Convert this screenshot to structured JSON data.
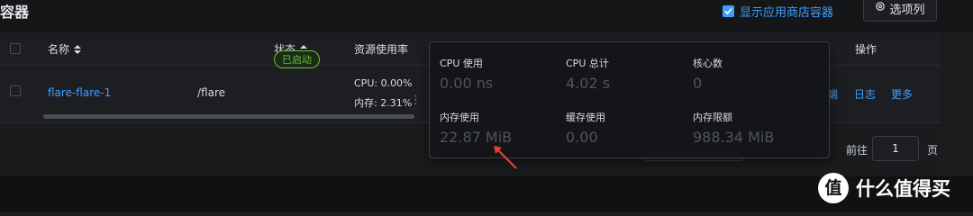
{
  "header": {
    "title": "容器",
    "show_store_label": "显示应用商店容器",
    "columns_button": "选项列"
  },
  "table": {
    "columns": {
      "name": "名称",
      "status": "状态",
      "resource": "资源使用率",
      "actions": "操作"
    },
    "rows": [
      {
        "name": "flare-flare-1",
        "image": "/flare",
        "status": "已启动",
        "cpu": "CPU: 0.00%",
        "memory": "内存: 2.31%",
        "actions": [
          "端",
          "日志",
          "更多"
        ]
      }
    ]
  },
  "pagination": {
    "goto_label": "前往",
    "page": "1",
    "page_suffix": "页"
  },
  "popover": {
    "cpu_usage_label": "CPU 使用",
    "cpu_usage_value": "0.00 ns",
    "cpu_total_label": "CPU 总计",
    "cpu_total_value": "4.02 s",
    "cores_label": "核心数",
    "cores_value": "0",
    "mem_usage_label": "内存使用",
    "mem_usage_value": "22.87 MiB",
    "cache_usage_label": "缓存使用",
    "cache_usage_value": "0.00",
    "mem_limit_label": "内存限额",
    "mem_limit_value": "988.34 MiB"
  },
  "watermark": {
    "logo_char": "值",
    "text": "什么值得买"
  },
  "colors": {
    "accent": "#409eff",
    "success": "#67c23a",
    "annotation_arrow": "#e8432f"
  }
}
